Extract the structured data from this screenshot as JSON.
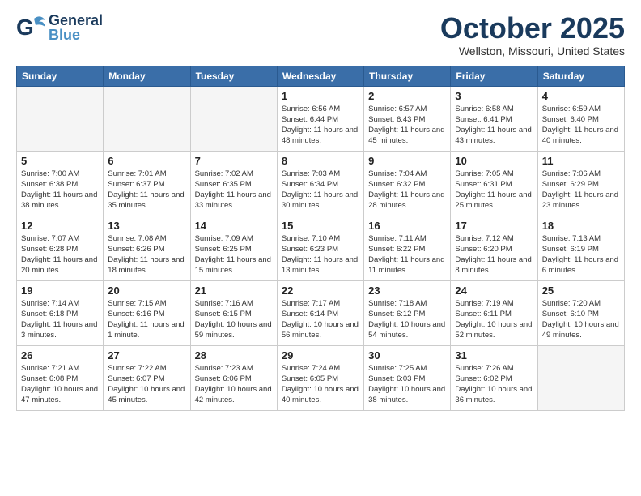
{
  "header": {
    "logo": {
      "general": "General",
      "blue": "Blue"
    },
    "title": "October 2025",
    "location": "Wellston, Missouri, United States"
  },
  "weekdays": [
    "Sunday",
    "Monday",
    "Tuesday",
    "Wednesday",
    "Thursday",
    "Friday",
    "Saturday"
  ],
  "weeks": [
    [
      {
        "day": "",
        "info": ""
      },
      {
        "day": "",
        "info": ""
      },
      {
        "day": "",
        "info": ""
      },
      {
        "day": "1",
        "info": "Sunrise: 6:56 AM\nSunset: 6:44 PM\nDaylight: 11 hours\nand 48 minutes."
      },
      {
        "day": "2",
        "info": "Sunrise: 6:57 AM\nSunset: 6:43 PM\nDaylight: 11 hours\nand 45 minutes."
      },
      {
        "day": "3",
        "info": "Sunrise: 6:58 AM\nSunset: 6:41 PM\nDaylight: 11 hours\nand 43 minutes."
      },
      {
        "day": "4",
        "info": "Sunrise: 6:59 AM\nSunset: 6:40 PM\nDaylight: 11 hours\nand 40 minutes."
      }
    ],
    [
      {
        "day": "5",
        "info": "Sunrise: 7:00 AM\nSunset: 6:38 PM\nDaylight: 11 hours\nand 38 minutes."
      },
      {
        "day": "6",
        "info": "Sunrise: 7:01 AM\nSunset: 6:37 PM\nDaylight: 11 hours\nand 35 minutes."
      },
      {
        "day": "7",
        "info": "Sunrise: 7:02 AM\nSunset: 6:35 PM\nDaylight: 11 hours\nand 33 minutes."
      },
      {
        "day": "8",
        "info": "Sunrise: 7:03 AM\nSunset: 6:34 PM\nDaylight: 11 hours\nand 30 minutes."
      },
      {
        "day": "9",
        "info": "Sunrise: 7:04 AM\nSunset: 6:32 PM\nDaylight: 11 hours\nand 28 minutes."
      },
      {
        "day": "10",
        "info": "Sunrise: 7:05 AM\nSunset: 6:31 PM\nDaylight: 11 hours\nand 25 minutes."
      },
      {
        "day": "11",
        "info": "Sunrise: 7:06 AM\nSunset: 6:29 PM\nDaylight: 11 hours\nand 23 minutes."
      }
    ],
    [
      {
        "day": "12",
        "info": "Sunrise: 7:07 AM\nSunset: 6:28 PM\nDaylight: 11 hours\nand 20 minutes."
      },
      {
        "day": "13",
        "info": "Sunrise: 7:08 AM\nSunset: 6:26 PM\nDaylight: 11 hours\nand 18 minutes."
      },
      {
        "day": "14",
        "info": "Sunrise: 7:09 AM\nSunset: 6:25 PM\nDaylight: 11 hours\nand 15 minutes."
      },
      {
        "day": "15",
        "info": "Sunrise: 7:10 AM\nSunset: 6:23 PM\nDaylight: 11 hours\nand 13 minutes."
      },
      {
        "day": "16",
        "info": "Sunrise: 7:11 AM\nSunset: 6:22 PM\nDaylight: 11 hours\nand 11 minutes."
      },
      {
        "day": "17",
        "info": "Sunrise: 7:12 AM\nSunset: 6:20 PM\nDaylight: 11 hours\nand 8 minutes."
      },
      {
        "day": "18",
        "info": "Sunrise: 7:13 AM\nSunset: 6:19 PM\nDaylight: 11 hours\nand 6 minutes."
      }
    ],
    [
      {
        "day": "19",
        "info": "Sunrise: 7:14 AM\nSunset: 6:18 PM\nDaylight: 11 hours\nand 3 minutes."
      },
      {
        "day": "20",
        "info": "Sunrise: 7:15 AM\nSunset: 6:16 PM\nDaylight: 11 hours\nand 1 minute."
      },
      {
        "day": "21",
        "info": "Sunrise: 7:16 AM\nSunset: 6:15 PM\nDaylight: 10 hours\nand 59 minutes."
      },
      {
        "day": "22",
        "info": "Sunrise: 7:17 AM\nSunset: 6:14 PM\nDaylight: 10 hours\nand 56 minutes."
      },
      {
        "day": "23",
        "info": "Sunrise: 7:18 AM\nSunset: 6:12 PM\nDaylight: 10 hours\nand 54 minutes."
      },
      {
        "day": "24",
        "info": "Sunrise: 7:19 AM\nSunset: 6:11 PM\nDaylight: 10 hours\nand 52 minutes."
      },
      {
        "day": "25",
        "info": "Sunrise: 7:20 AM\nSunset: 6:10 PM\nDaylight: 10 hours\nand 49 minutes."
      }
    ],
    [
      {
        "day": "26",
        "info": "Sunrise: 7:21 AM\nSunset: 6:08 PM\nDaylight: 10 hours\nand 47 minutes."
      },
      {
        "day": "27",
        "info": "Sunrise: 7:22 AM\nSunset: 6:07 PM\nDaylight: 10 hours\nand 45 minutes."
      },
      {
        "day": "28",
        "info": "Sunrise: 7:23 AM\nSunset: 6:06 PM\nDaylight: 10 hours\nand 42 minutes."
      },
      {
        "day": "29",
        "info": "Sunrise: 7:24 AM\nSunset: 6:05 PM\nDaylight: 10 hours\nand 40 minutes."
      },
      {
        "day": "30",
        "info": "Sunrise: 7:25 AM\nSunset: 6:03 PM\nDaylight: 10 hours\nand 38 minutes."
      },
      {
        "day": "31",
        "info": "Sunrise: 7:26 AM\nSunset: 6:02 PM\nDaylight: 10 hours\nand 36 minutes."
      },
      {
        "day": "",
        "info": ""
      }
    ]
  ]
}
